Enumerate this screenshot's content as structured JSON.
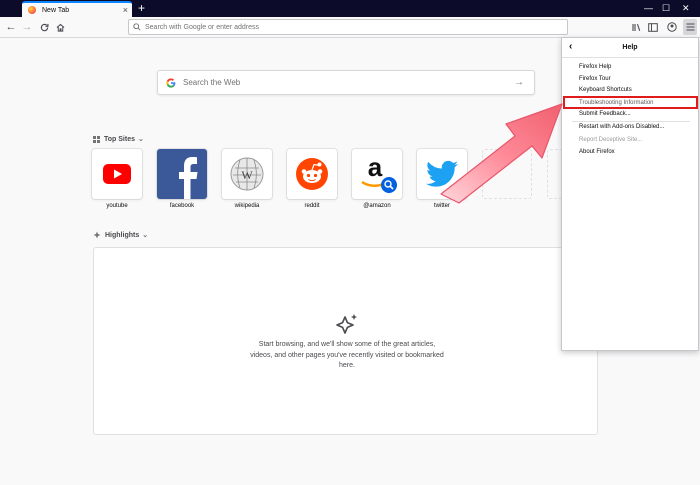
{
  "browser": {
    "tab_title": "New Tab",
    "urlbar_placeholder": "Search with Google or enter address"
  },
  "newtab": {
    "search_placeholder": "Search the Web",
    "top_sites_title": "Top Sites",
    "highlights_title": "Highlights",
    "highlights_empty_text": "Start browsing, and we'll show some of the great articles, videos, and other pages you've recently visited or bookmarked here.",
    "tiles": [
      {
        "label": "youtube",
        "icon": "youtube-icon"
      },
      {
        "label": "facebook",
        "icon": "facebook-icon"
      },
      {
        "label": "wikipedia",
        "icon": "wikipedia-icon"
      },
      {
        "label": "reddit",
        "icon": "reddit-icon"
      },
      {
        "label": "@amazon",
        "icon": "amazon-icon"
      },
      {
        "label": "twitter",
        "icon": "twitter-icon"
      }
    ]
  },
  "help_menu": {
    "title": "Help",
    "items": [
      {
        "label": "Firefox Help",
        "enabled": true
      },
      {
        "label": "Firefox Tour",
        "enabled": true
      },
      {
        "label": "Keyboard Shortcuts",
        "enabled": true
      },
      {
        "label": "Troubleshooting Information",
        "enabled": true
      },
      {
        "label": "Submit Feedback...",
        "enabled": true
      },
      {
        "label": "Restart with Add-ons Disabled...",
        "enabled": true
      },
      {
        "label": "Report Deceptive Site...",
        "enabled": false
      },
      {
        "label": "About Firefox",
        "enabled": true
      }
    ]
  },
  "colors": {
    "accent": "#0a84ff",
    "annotation_red": "#e01b1b",
    "titlebar": "#0c0c2a"
  }
}
